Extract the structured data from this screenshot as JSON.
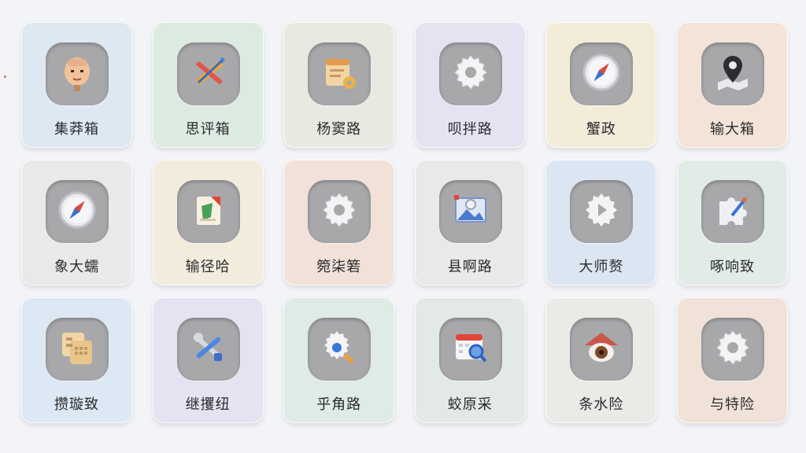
{
  "tiles": [
    {
      "label": "集莽箱",
      "icon": "face-avatar-icon",
      "bg": "#dde8f3"
    },
    {
      "label": "思评箱",
      "icon": "ruler-pencil-arrow-icon",
      "bg": "#dcebe2"
    },
    {
      "label": "杨窦路",
      "icon": "notebook-gear-icon",
      "bg": "#e6eae0"
    },
    {
      "label": "呗拌路",
      "icon": "gear-icon",
      "bg": "#e3e3f2"
    },
    {
      "label": "蟹政",
      "icon": "compass-icon",
      "bg": "#f3ecd9"
    },
    {
      "label": "输大箱",
      "icon": "map-pin-icon",
      "bg": "#f3e3d8"
    },
    {
      "label": "象大蠕",
      "icon": "compass-icon",
      "bg": "#e9e9ea"
    },
    {
      "label": "输径哈",
      "icon": "document-pen-icon",
      "bg": "#f1ecdc"
    },
    {
      "label": "箢柒箬",
      "icon": "gear-icon",
      "bg": "#f1e1d8"
    },
    {
      "label": "县啊路",
      "icon": "photo-icon",
      "bg": "#e9e9ea"
    },
    {
      "label": "大师赘",
      "icon": "play-gear-icon",
      "bg": "#dbe6f2"
    },
    {
      "label": "啄响致",
      "icon": "puzzle-brush-icon",
      "bg": "#e2ece7"
    },
    {
      "label": "攒璇致",
      "icon": "document-stack-icon",
      "bg": "#dce8f3"
    },
    {
      "label": "继攫纽",
      "icon": "wrench-tools-icon",
      "bg": "#e5e3f1"
    },
    {
      "label": "乎角路",
      "icon": "gear-search-icon",
      "bg": "#dfebe5"
    },
    {
      "label": "蛟原采",
      "icon": "calendar-search-icon",
      "bg": "#e3e9e6"
    },
    {
      "label": "条水险",
      "icon": "house-eye-icon",
      "bg": "#e9ebe7"
    },
    {
      "label": "与特险",
      "icon": "gear-icon",
      "bg": "#f1e2d9"
    }
  ]
}
